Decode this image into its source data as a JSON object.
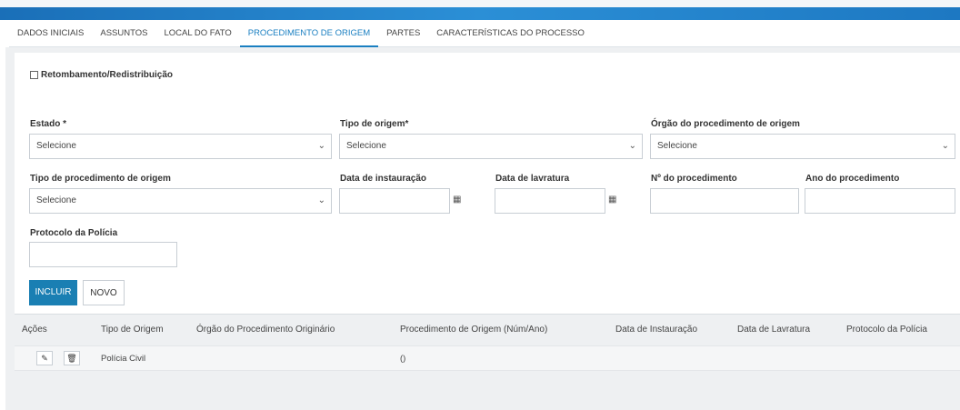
{
  "tabs": [
    {
      "label": "DADOS INICIAIS"
    },
    {
      "label": "ASSUNTOS"
    },
    {
      "label": "LOCAL DO FATO"
    },
    {
      "label": "PROCEDIMENTO DE ORIGEM"
    },
    {
      "label": "PARTES"
    },
    {
      "label": "CARACTERÍSTICAS DO PROCESSO"
    }
  ],
  "form": {
    "retombamento_label": "Retombamento/Redistribuição",
    "estado_label": "Estado *",
    "estado_value": "Selecione",
    "tipo_origem_label": "Tipo de origem*",
    "tipo_origem_value": "Selecione",
    "orgao_label": "Órgão do procedimento de origem",
    "orgao_value": "Selecione",
    "tipo_proc_label": "Tipo de procedimento de origem",
    "tipo_proc_value": "Selecione",
    "data_instauracao_label": "Data de instauração",
    "data_lavratura_label": "Data de lavratura",
    "num_proc_label": "Nº do procedimento",
    "ano_proc_label": "Ano do procedimento",
    "protocolo_label": "Protocolo da Polícia"
  },
  "buttons": {
    "incluir": "INCLUIR",
    "novo": "NOVO"
  },
  "table": {
    "headers": [
      "Ações",
      "Tipo de Origem",
      "Órgão do Procedimento Originário",
      "Procedimento de Origem (Núm/Ano)",
      "Data de Instauração",
      "Data de Lavratura",
      "Protocolo da Polícia"
    ],
    "rows": [
      {
        "tipo_origem": "Polícia Civil",
        "procedimento": "()"
      }
    ]
  },
  "icons": {
    "select_caret": "⌄",
    "calendar": "▦",
    "edit": "✎",
    "delete": "🗑"
  },
  "colors": {
    "accent": "#1a7fc1",
    "primary_button": "#1a7fb3"
  }
}
